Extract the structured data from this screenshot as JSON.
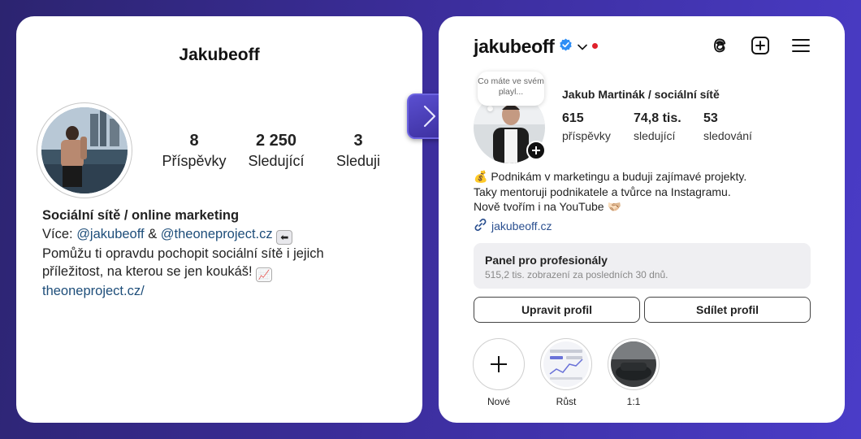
{
  "old_profile": {
    "username": "Jakubeoff",
    "stats": [
      {
        "value": "8",
        "label": "Příspěvky"
      },
      {
        "value": "2 250",
        "label": "Sledující"
      },
      {
        "value": "3",
        "label": "Sleduji"
      }
    ],
    "bio_name": "Sociální sítě / online marketing",
    "bio_line1_prefix": "Více: ",
    "bio_mention1": "@jakubeoff",
    "bio_amp": " & ",
    "bio_mention2": "@theoneproject.cz",
    "bio_line2": "Pomůžu ti opravdu pochopit sociální sítě i jejich",
    "bio_line3": "příležitost, na kterou se jen koukáš! ",
    "bio_link": "theoneproject.cz/"
  },
  "new_profile": {
    "handle": "jakubeoff",
    "note": "Co máte ve svém playl...",
    "full_name": "Jakub Martinák / sociální sítě",
    "stats": [
      {
        "value": "615",
        "label": "příspěvky"
      },
      {
        "value": "74,8 tis.",
        "label": "sledující"
      },
      {
        "value": "53",
        "label": "sledování"
      }
    ],
    "bio_line1": "💰 Podnikám v marketingu a buduji zajímavé projekty.",
    "bio_line2": "Taky mentoruji podnikatele a tvůrce na Instagramu.",
    "bio_line3": "Nově tvořím i na YouTube 🫱🏻‍🫲🏼",
    "link": "jakubeoff.cz",
    "panel_title": "Panel pro profesionály",
    "panel_subtitle": "515,2 tis. zobrazení za posledních 30 dnů.",
    "edit_button": "Upravit profil",
    "share_button": "Sdílet profil",
    "highlights": [
      {
        "label": "Nové"
      },
      {
        "label": "Růst"
      },
      {
        "label": "1:1"
      }
    ]
  },
  "colors": {
    "accent": "#3b2d9a",
    "verified": "#2f8ef5",
    "notification_dot": "#e0202a",
    "link": "#1e4e7a"
  }
}
